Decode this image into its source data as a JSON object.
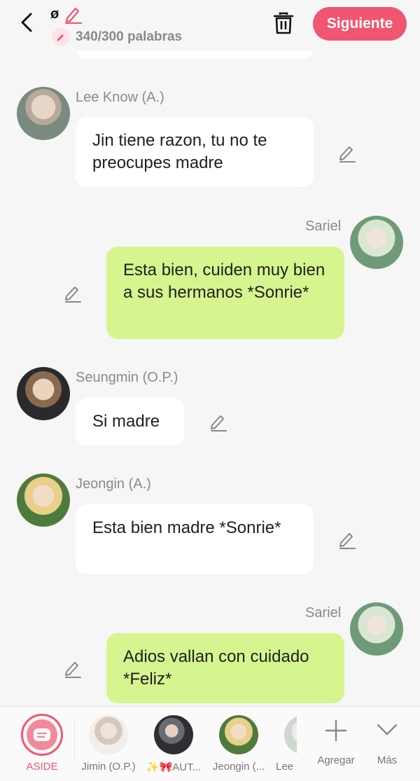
{
  "header": {
    "title": "ø",
    "words": "340/300 palabras",
    "next_label": "Siguiente",
    "accent": "#f0566f"
  },
  "messages": [
    {
      "sender": "Lee Know (A.)",
      "text": "Jin tiene razon, tu no te preocupes madre",
      "side": "left"
    },
    {
      "sender": "Sariel",
      "text": "Esta bien, cuiden muy bien a sus hermanos *Sonrie*",
      "side": "right"
    },
    {
      "sender": "Seungmin (O.P.)",
      "text": "Si madre",
      "side": "left"
    },
    {
      "sender": "Jeongin (A.)",
      "text": "Esta bien madre *Sonrie*",
      "side": "left"
    },
    {
      "sender": "Sariel",
      "text": "Adios vallan con cuidado *Feliz*",
      "side": "right"
    }
  ],
  "bottom_bar": {
    "aside_label": "ASIDE",
    "characters": [
      {
        "label": "Jimin (O.P.)"
      },
      {
        "label": "✨🎀AUT..."
      },
      {
        "label": "Jeongin (..."
      },
      {
        "label": "Lee"
      }
    ],
    "add_label": "Agregar",
    "more_label": "Más"
  },
  "colors": {
    "bubble_self": "#d6f58e",
    "bubble_other": "#ffffff",
    "background": "#f6f6f6"
  }
}
